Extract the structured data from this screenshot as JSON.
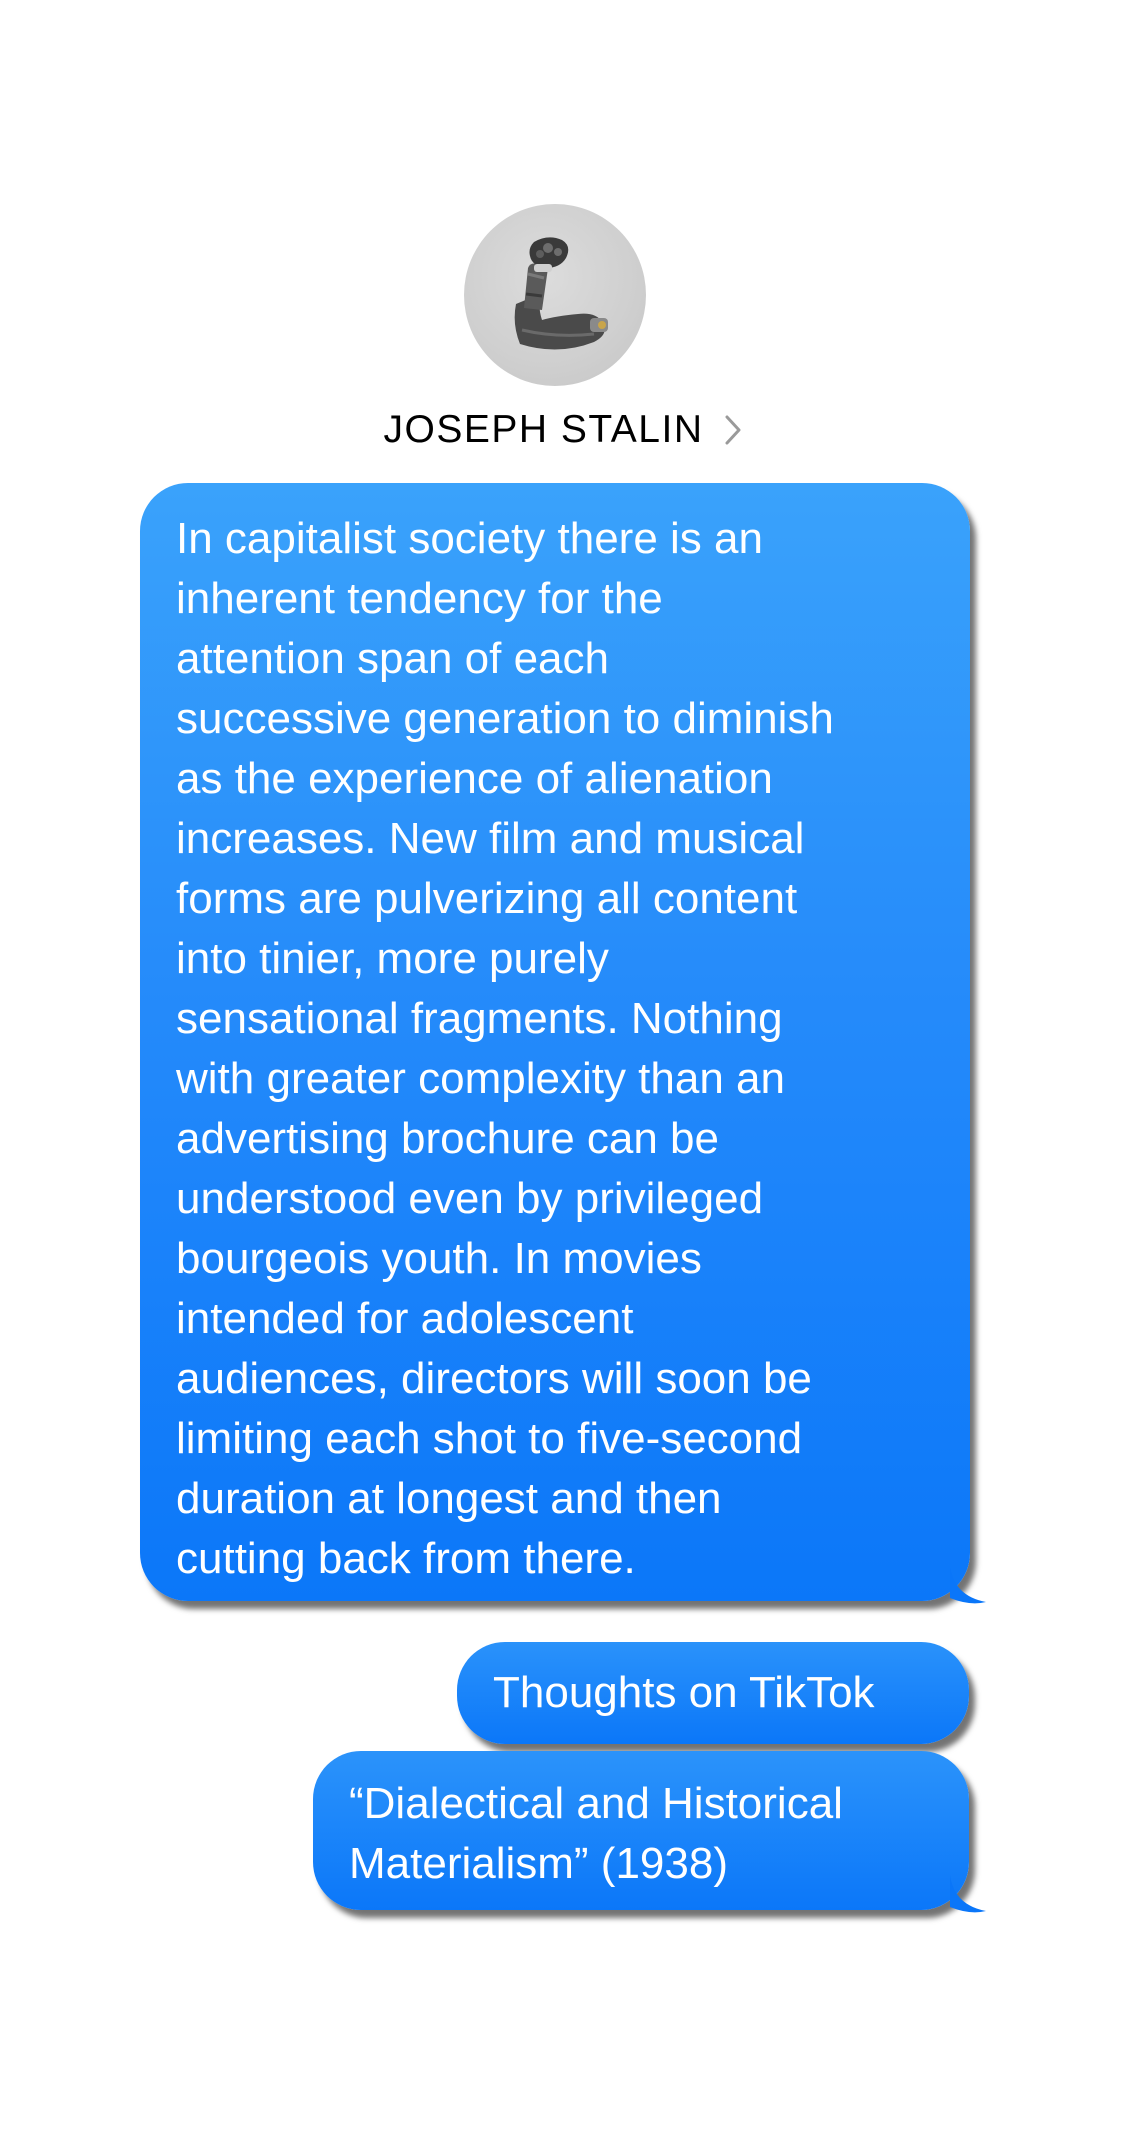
{
  "contact": {
    "name": "JOSEPH STALIN",
    "avatar_icon": "mechanical-arm-icon"
  },
  "messages": [
    {
      "text": "In capitalist society there is an\ninherent tendency for the\nattention span of each\nsuccessive generation to diminish\nas the experience of alienation\nincreases. New film and musical\nforms are pulverizing all content\ninto tinier, more purely\nsensational fragments. Nothing\nwith greater complexity than an\nadvertising brochure can be\nunderstood even by privileged\nbourgeois youth. In movies\nintended for adolescent\naudiences, directors will soon be\nlimiting each shot to five-second\nduration at longest and then\ncutting back from there."
    },
    {
      "text": "Thoughts on TikTok"
    },
    {
      "text": "“Dialectical and Historical\nMaterialism” (1938)"
    }
  ],
  "colors": {
    "bubble_top": "#3aa0fb",
    "bubble_bottom": "#0a76f9",
    "text": "#ffffff",
    "avatar_bg": "#cfcfcf"
  }
}
